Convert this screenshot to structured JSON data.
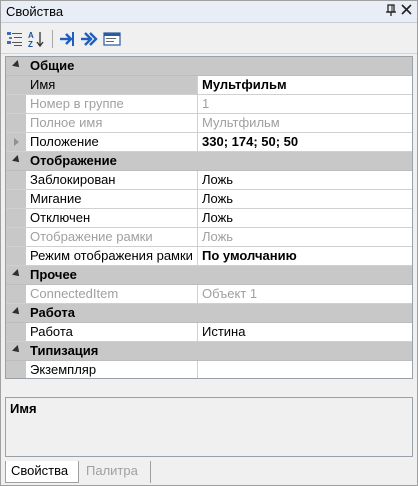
{
  "window": {
    "title": "Свойства",
    "pin_glyph": "▫",
    "close_glyph": "✕"
  },
  "toolbar": {
    "icons": [
      "categorized-icon",
      "alphabetical-sort-icon",
      "go-to-icon",
      "navigate-icon",
      "property-pages-icon"
    ]
  },
  "grid": {
    "categories": [
      {
        "label": "Общие",
        "rows": [
          {
            "name": "Имя",
            "value": "Мультфильм",
            "value_bold": true,
            "selected": true
          },
          {
            "name": "Номер в группе",
            "value": "1",
            "dim": true
          },
          {
            "name": "Полное имя",
            "value": "Мультфильм",
            "dim": true
          },
          {
            "name": "Положение",
            "value": "330; 174; 50; 50",
            "value_bold": true,
            "expandable": true
          }
        ]
      },
      {
        "label": "Отображение",
        "rows": [
          {
            "name": "Заблокирован",
            "value": "Ложь"
          },
          {
            "name": "Мигание",
            "value": "Ложь"
          },
          {
            "name": "Отключен",
            "value": "Ложь"
          },
          {
            "name": "Отображение рамки",
            "value": "Ложь",
            "dim": true
          },
          {
            "name": "Режим отображения рамки",
            "value": "По умолчанию",
            "value_bold": true
          }
        ]
      },
      {
        "label": "Прочее",
        "rows": [
          {
            "name": "ConnectedItem",
            "value": "Объект 1",
            "dim": true
          }
        ]
      },
      {
        "label": "Работа",
        "rows": [
          {
            "name": "Работа",
            "value": "Истина"
          }
        ]
      },
      {
        "label": "Типизация",
        "rows": [
          {
            "name": "Экземпляр",
            "value": ""
          }
        ]
      }
    ]
  },
  "description": {
    "title": "Имя"
  },
  "tabs": [
    {
      "label": "Свойства",
      "active": true
    },
    {
      "label": "Палитра",
      "active": false
    }
  ]
}
